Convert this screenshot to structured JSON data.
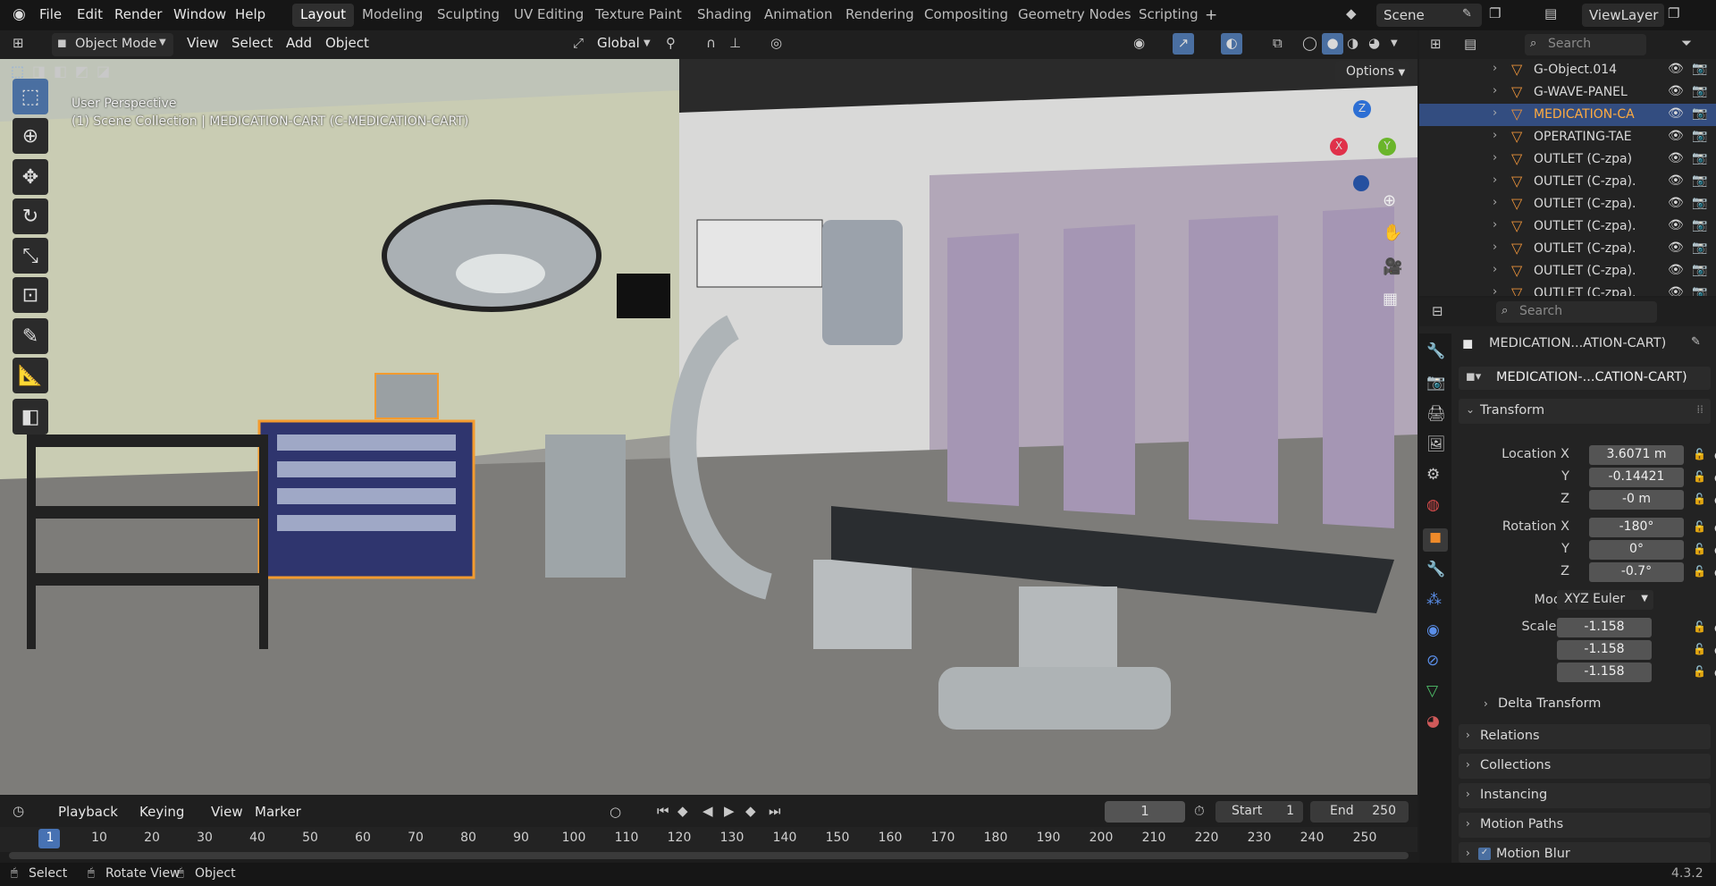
{
  "menus": [
    "File",
    "Edit",
    "Render",
    "Window",
    "Help"
  ],
  "workspaces": [
    "Layout",
    "Modeling",
    "Sculpting",
    "UV Editing",
    "Texture Paint",
    "Shading",
    "Animation",
    "Rendering",
    "Compositing",
    "Geometry Nodes",
    "Scripting"
  ],
  "scene": "Scene",
  "view_layer": "ViewLayer",
  "viewport": {
    "mode": "Object Mode",
    "menus": [
      "View",
      "Select",
      "Add",
      "Object"
    ],
    "orientation": "Global",
    "options": "Options",
    "overlay_title": "User Perspective",
    "overlay_sub": "(1) Scene Collection | MEDICATION-CART (C-MEDICATION-CART)",
    "gizmo": {
      "x": "X",
      "y": "Y",
      "z": "Z"
    }
  },
  "outliner": {
    "search_placeholder": "Search",
    "items": [
      {
        "name": "G-Object.014"
      },
      {
        "name": "G-WAVE-PANEL"
      },
      {
        "name": "MEDICATION-CA"
      },
      {
        "name": "OPERATING-TAE"
      },
      {
        "name": "OUTLET (C-zpa)"
      },
      {
        "name": "OUTLET (C-zpa)."
      },
      {
        "name": "OUTLET (C-zpa)."
      },
      {
        "name": "OUTLET (C-zpa)."
      },
      {
        "name": "OUTLET (C-zpa)."
      },
      {
        "name": "OUTLET (C-zpa)."
      },
      {
        "name": "OUTLET (C-zpa)."
      }
    ]
  },
  "properties": {
    "search_placeholder": "Search",
    "object_name": "MEDICATION...ATION-CART)",
    "data_name": "MEDICATION-...CATION-CART)",
    "transform_label": "Transform",
    "location_label": "Location X",
    "rotation_label": "Rotation X",
    "scale_label": "Scale X",
    "mode_label": "Mode",
    "y_label": "Y",
    "z_label": "Z",
    "location": [
      "3.6071 m",
      "-0.14421",
      "-0 m"
    ],
    "rotation": [
      "-180°",
      "0°",
      "-0.7°"
    ],
    "mode": "XYZ Euler",
    "scale": [
      "-1.158",
      "-1.158",
      "-1.158"
    ],
    "delta": "Delta Transform",
    "panels": [
      "Relations",
      "Collections",
      "Instancing",
      "Motion Paths",
      "Motion Blur"
    ]
  },
  "timeline": {
    "menus": [
      "Playback",
      "Keying",
      "View",
      "Marker"
    ],
    "current_frame": "1",
    "start_label": "Start",
    "start": "1",
    "end_label": "End",
    "end": "250",
    "ticks": [
      "1",
      "10",
      "20",
      "30",
      "40",
      "50",
      "60",
      "70",
      "80",
      "90",
      "100",
      "110",
      "120",
      "130",
      "140",
      "150",
      "160",
      "170",
      "180",
      "190",
      "200",
      "210",
      "220",
      "230",
      "240",
      "250"
    ]
  },
  "status": {
    "select": "Select",
    "rotate": "Rotate View",
    "object": "Object",
    "version": "4.3.2"
  }
}
